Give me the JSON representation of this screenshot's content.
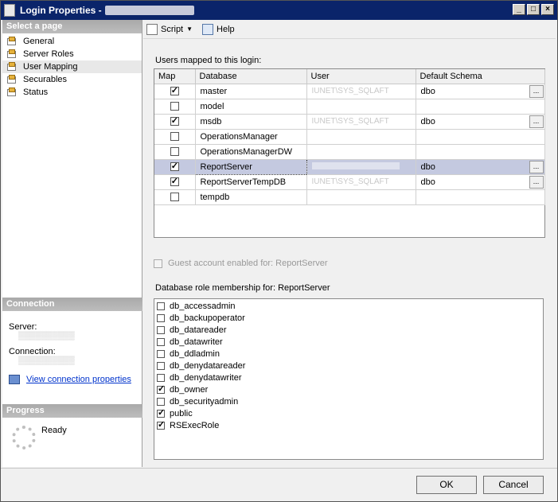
{
  "window": {
    "title": "Login Properties -"
  },
  "left": {
    "select_header": "Select a page",
    "pages": [
      {
        "label": "General"
      },
      {
        "label": "Server Roles"
      },
      {
        "label": "User Mapping",
        "selected": true
      },
      {
        "label": "Securables"
      },
      {
        "label": "Status"
      }
    ],
    "connection_header": "Connection",
    "server_label": "Server:",
    "connection_label": "Connection:",
    "view_link": "View connection properties",
    "progress_header": "Progress",
    "status": "Ready"
  },
  "toolbar": {
    "script_label": "Script",
    "help_label": "Help"
  },
  "users_label": "Users mapped to this login:",
  "grid": {
    "columns": [
      "Map",
      "Database",
      "User",
      "Default Schema"
    ],
    "rows": [
      {
        "map": true,
        "database": "master",
        "user": "IUNET\\SYS_SQLAFT",
        "schema": "dbo"
      },
      {
        "map": false,
        "database": "model",
        "user": "",
        "schema": ""
      },
      {
        "map": true,
        "database": "msdb",
        "user": "IUNET\\SYS_SQLAFT",
        "schema": "dbo"
      },
      {
        "map": false,
        "database": "OperationsManager",
        "user": "",
        "schema": ""
      },
      {
        "map": false,
        "database": "OperationsManagerDW",
        "user": "",
        "schema": ""
      },
      {
        "map": true,
        "database": "ReportServer",
        "user": "",
        "schema": "dbo",
        "selected": true
      },
      {
        "map": true,
        "database": "ReportServerTempDB",
        "user": "IUNET\\SYS_SQLAFT",
        "schema": "dbo"
      },
      {
        "map": false,
        "database": "tempdb",
        "user": "",
        "schema": ""
      }
    ]
  },
  "guest_label": "Guest account enabled for: ReportServer",
  "roles_label": "Database role membership for: ReportServer",
  "roles": [
    {
      "name": "db_accessadmin",
      "checked": false
    },
    {
      "name": "db_backupoperator",
      "checked": false
    },
    {
      "name": "db_datareader",
      "checked": false
    },
    {
      "name": "db_datawriter",
      "checked": false
    },
    {
      "name": "db_ddladmin",
      "checked": false
    },
    {
      "name": "db_denydatareader",
      "checked": false
    },
    {
      "name": "db_denydatawriter",
      "checked": false
    },
    {
      "name": "db_owner",
      "checked": true
    },
    {
      "name": "db_securityadmin",
      "checked": false
    },
    {
      "name": "public",
      "checked": true
    },
    {
      "name": "RSExecRole",
      "checked": true
    }
  ],
  "buttons": {
    "ok": "OK",
    "cancel": "Cancel"
  }
}
